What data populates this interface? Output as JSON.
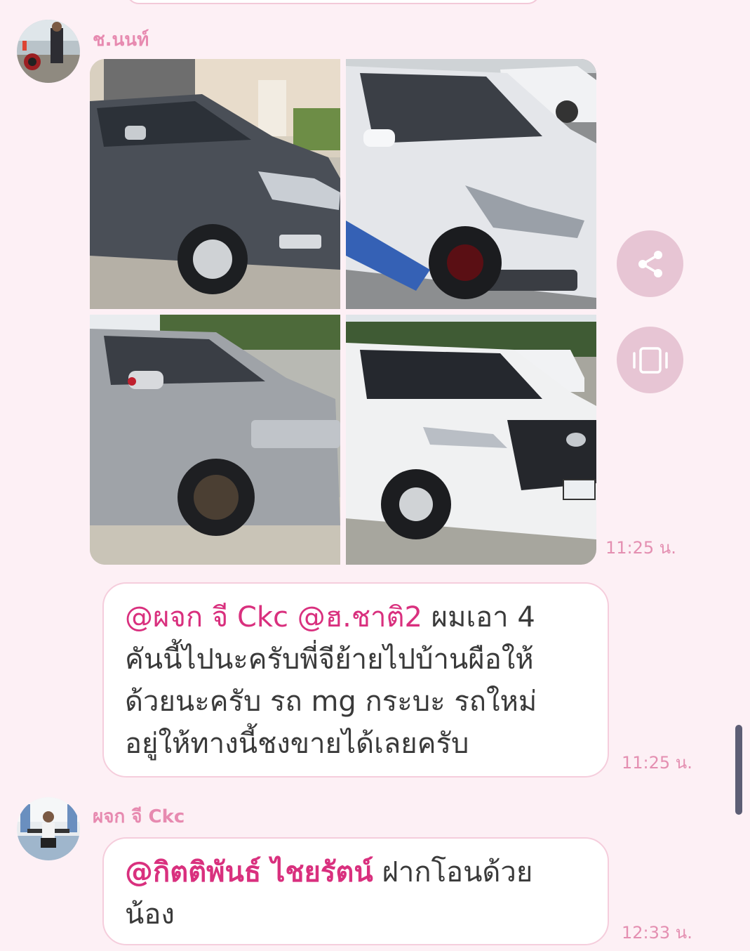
{
  "messages": [
    {
      "sender": "ช.นนท์",
      "time": "11:25 น.",
      "photos": [
        {
          "label": "car-dark-grey-ford-ranger"
        },
        {
          "label": "car-white-sedan"
        },
        {
          "label": "car-silver-toyota-hilux"
        },
        {
          "label": "car-white-toyota-hilux"
        }
      ]
    },
    {
      "time": "11:25 น.",
      "mention1": "@ผจก จี Ckc",
      "mention2": "@ฮ.ชาติ2",
      "line1_rest": "ผมเอา 4",
      "line2": "คันนี้ไปนะครับพี่จีย้ายไปบ้านผือให้",
      "line3": "ด้วยนะครับ รถ mg กระบะ รถใหม่",
      "line4": "อยู่ให้ทางนี้ชงขายได้เลยครับ"
    },
    {
      "sender": "ผจก จี Ckc",
      "time": "12:33 น.",
      "mention": "@กิตติพันธ์ ไชยรัตน์",
      "line1_rest": "ฝากโอนด้วย",
      "line2": "น้อง"
    }
  ],
  "actions": {
    "share_icon": "share-icon",
    "album_icon": "view-album-icon"
  },
  "colors": {
    "background": "#fdf0f5",
    "sender_name": "#e78ab0",
    "mention": "#d9307e",
    "timestamp": "#e48fb1",
    "action_button": "#e7c5d4"
  }
}
